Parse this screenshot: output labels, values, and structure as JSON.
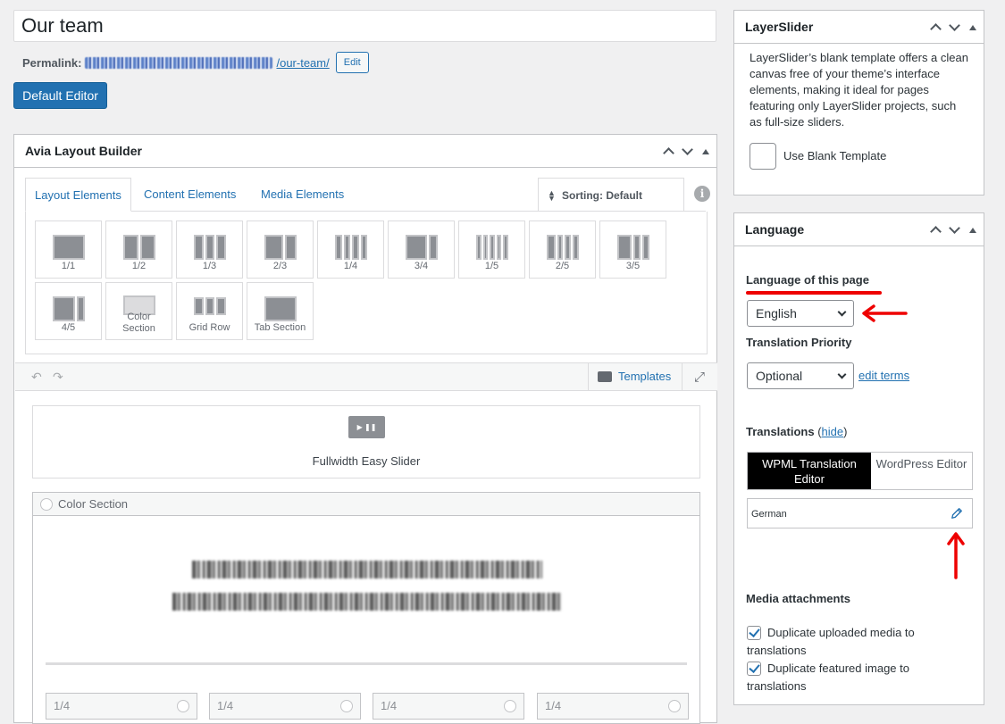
{
  "post": {
    "title": "Our team",
    "permalink_label": "Permalink:",
    "permalink_slug": "/our-team/",
    "permalink_edit": "Edit",
    "default_editor": "Default Editor"
  },
  "avia": {
    "title": "Avia Layout Builder",
    "tabs": [
      {
        "label": "Layout Elements"
      },
      {
        "label": "Content Elements"
      },
      {
        "label": "Media Elements"
      }
    ],
    "sorting": "Sorting: Default",
    "elements": [
      "1/1",
      "1/2",
      "1/3",
      "2/3",
      "1/4",
      "3/4",
      "1/5",
      "2/5",
      "3/5",
      "4/5",
      "Color Section",
      "Grid Row",
      "Tab Section"
    ],
    "templates": "Templates",
    "slider_label": "Fullwidth Easy Slider",
    "color_section_label": "Color Section",
    "quarters": [
      "1/4",
      "1/4",
      "1/4",
      "1/4"
    ]
  },
  "layerslider": {
    "title": "LayerSlider",
    "description": "LayerSlider’s blank template offers a clean canvas free of your theme’s interface elements, making it ideal for pages featuring only LayerSlider projects, such as full-size sliders.",
    "checkbox_label": "Use Blank Template"
  },
  "language": {
    "title": "Language",
    "language_label": "Language of this page",
    "language_value": "English",
    "priority_label": "Translation Priority",
    "priority_value": "Optional",
    "edit_terms": "edit terms",
    "translations_label": "Translations",
    "hide_link": "hide",
    "wpml_editor": "WPML Translation Editor",
    "wp_editor": "WordPress Editor",
    "german": "German",
    "media_label": "Media attachments",
    "dup_media_1": "Duplicate uploaded media to",
    "dup_media_2": "translations",
    "dup_featured_1": "Duplicate featured image to",
    "dup_featured_2": "translations"
  },
  "colors": {
    "wp_blue": "#2271b1",
    "annotation_red": "#e00000"
  }
}
